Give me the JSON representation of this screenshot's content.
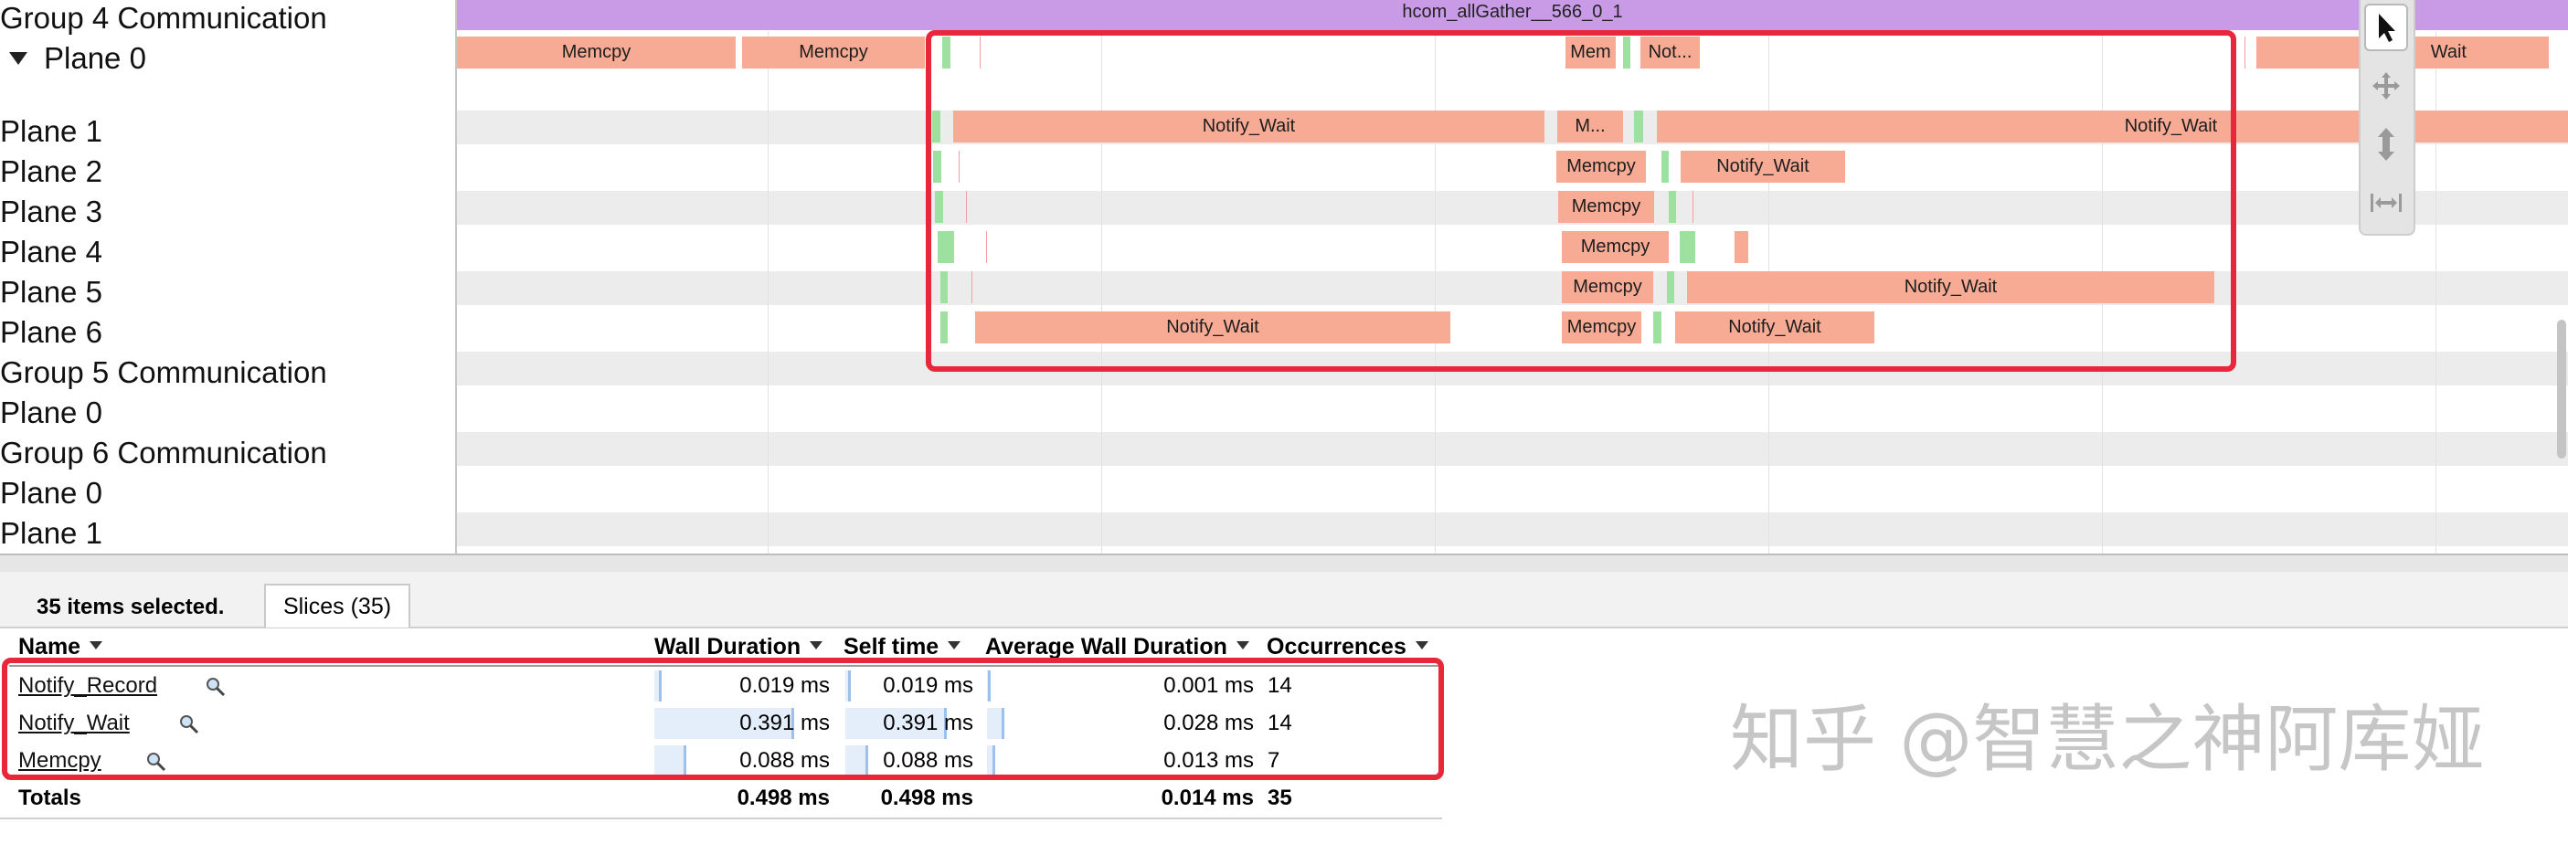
{
  "track_labels": [
    {
      "text": "Group 4 Communication"
    },
    {
      "text": "Plane 0",
      "expanded": true
    },
    {
      "text": "Plane 1"
    },
    {
      "text": "Plane 2"
    },
    {
      "text": "Plane 3"
    },
    {
      "text": "Plane 4"
    },
    {
      "text": "Plane 5"
    },
    {
      "text": "Plane 6"
    },
    {
      "text": "Group 5 Communication"
    },
    {
      "text": "Plane 0"
    },
    {
      "text": "Group 6 Communication"
    },
    {
      "text": "Plane 0"
    },
    {
      "text": "Plane 1"
    }
  ],
  "timeline": {
    "comm_slice_label": "hcom_allGather__566_0_1",
    "slice_labels": {
      "memcpy": "Memcpy",
      "mem": "Mem",
      "not": "Not...",
      "notify_wait": "Notify_Wait",
      "m": "M...",
      "partial_wait": "Wait"
    },
    "colors": {
      "comm_bar": "#c99ae6",
      "slice_wait": "#f7ab95",
      "slice_record": "#9ee0a0",
      "highlight": "#e8283a"
    }
  },
  "toolbar": {
    "tools": [
      {
        "icon": "pointer-icon",
        "active": true
      },
      {
        "icon": "pan-icon",
        "active": false
      },
      {
        "icon": "zoom-icon",
        "active": false
      },
      {
        "icon": "timing-icon",
        "active": false
      }
    ]
  },
  "panel": {
    "selection_text": "35 items selected.",
    "tab_label": "Slices (35)",
    "columns": [
      "Name",
      "Wall Duration",
      "Self time",
      "Average Wall Duration",
      "Occurrences"
    ],
    "rows": [
      {
        "name": "Notify_Record",
        "wall": "0.019 ms",
        "self": "0.019 ms",
        "avg": "0.001 ms",
        "occ": "14",
        "wall_fraction": 0.04,
        "self_fraction": 0.04,
        "avg_fraction": 0.07
      },
      {
        "name": "Notify_Wait",
        "wall": "0.391 ms",
        "self": "0.391 ms",
        "avg": "0.028 ms",
        "occ": "14",
        "wall_fraction": 0.79,
        "self_fraction": 0.79,
        "avg_fraction": 0.93
      },
      {
        "name": "Memcpy",
        "wall": "0.088 ms",
        "self": "0.088 ms",
        "avg": "0.013 ms",
        "occ": "7",
        "wall_fraction": 0.18,
        "self_fraction": 0.18,
        "avg_fraction": 0.43
      }
    ],
    "totals": {
      "label": "Totals",
      "wall": "0.498 ms",
      "self": "0.498 ms",
      "avg": "0.014 ms",
      "occ": "35"
    }
  },
  "watermark": "知乎 @智慧之神阿库娅"
}
